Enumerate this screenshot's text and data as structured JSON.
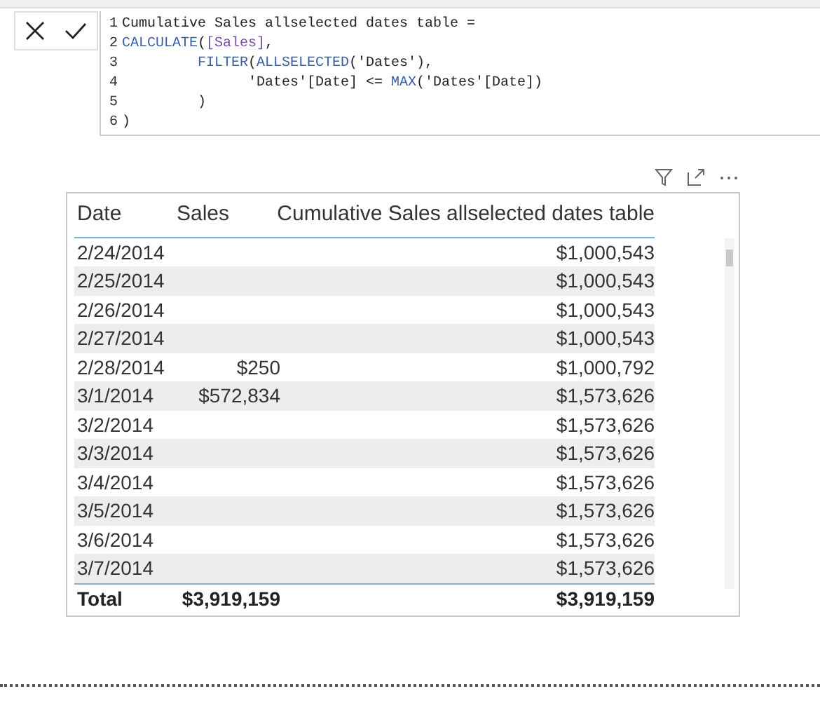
{
  "formula_bar": {
    "line_numbers": [
      "1",
      "2",
      "3",
      "4",
      "5",
      "6"
    ],
    "lines": [
      {
        "kind": "top",
        "segments": [
          {
            "kind": "plain",
            "text": "Cumulative Sales allselected dates table ="
          }
        ]
      },
      {
        "kind": "top",
        "segments": [
          {
            "kind": "function",
            "text": "CALCULATE"
          },
          {
            "kind": "plain",
            "text": "("
          },
          {
            "kind": "measure",
            "text": "[Sales]"
          },
          {
            "kind": "plain",
            "text": ","
          }
        ]
      },
      {
        "kind": "inner",
        "segments": [
          {
            "kind": "function",
            "text": "FILTER"
          },
          {
            "kind": "plain",
            "text": "("
          },
          {
            "kind": "function",
            "text": "ALLSELECTED"
          },
          {
            "kind": "plain",
            "text": "('Dates'),"
          }
        ]
      },
      {
        "kind": "deep",
        "segments": [
          {
            "kind": "plain",
            "text": "'Dates'[Date] <= "
          },
          {
            "kind": "function",
            "text": "MAX"
          },
          {
            "kind": "plain",
            "text": "('Dates'[Date])"
          }
        ]
      },
      {
        "kind": "inner",
        "segments": [
          {
            "kind": "plain",
            "text": ")"
          }
        ]
      },
      {
        "kind": "top",
        "segments": [
          {
            "kind": "plain",
            "text": ")"
          }
        ]
      }
    ]
  },
  "table": {
    "columns": [
      "Date",
      "Sales",
      "Cumulative Sales allselected dates table"
    ],
    "rows": [
      [
        "2/24/2014",
        "",
        "$1,000,543"
      ],
      [
        "2/25/2014",
        "",
        "$1,000,543"
      ],
      [
        "2/26/2014",
        "",
        "$1,000,543"
      ],
      [
        "2/27/2014",
        "",
        "$1,000,543"
      ],
      [
        "2/28/2014",
        "$250",
        "$1,000,792"
      ],
      [
        "3/1/2014",
        "$572,834",
        "$1,573,626"
      ],
      [
        "3/2/2014",
        "",
        "$1,573,626"
      ],
      [
        "3/3/2014",
        "",
        "$1,573,626"
      ],
      [
        "3/4/2014",
        "",
        "$1,573,626"
      ],
      [
        "3/5/2014",
        "",
        "$1,573,626"
      ],
      [
        "3/6/2014",
        "",
        "$1,573,626"
      ],
      [
        "3/7/2014",
        "",
        "$1,573,626"
      ]
    ],
    "total": [
      "Total",
      "$3,919,159",
      "$3,919,159"
    ]
  }
}
